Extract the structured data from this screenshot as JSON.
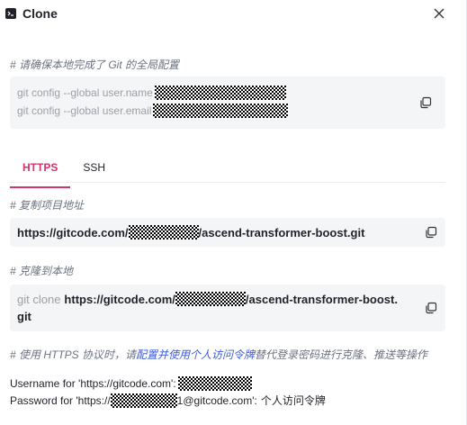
{
  "header": {
    "title": "Clone",
    "app_icon": "terminal-icon",
    "close_icon": "close-icon"
  },
  "config": {
    "note": "# 请确保本地完成了 Git 的全局配置",
    "line1": "git config --global user.name",
    "line2": "git config --global user.email"
  },
  "tabs": [
    {
      "label": "HTTPS",
      "active": true
    },
    {
      "label": "SSH",
      "active": false
    }
  ],
  "copy_url": {
    "note": "# 复制项目地址",
    "url_prefix": "https://gitcode.com/",
    "url_suffix": "/ascend-transformer-boost.git"
  },
  "clone_local": {
    "note": "# 克隆到本地",
    "cmd": "git clone",
    "url_prefix": "https://gitcode.com/",
    "url_suffix": "/ascend-transformer-boost.",
    "url_tail": "git"
  },
  "https_note": {
    "before": "# 使用 HTTPS 协议时，请",
    "link": "配置并使用个人访问令牌",
    "after": "替代登录密码进行克隆、推送等操作"
  },
  "credentials": {
    "username_prefix": "Username for 'https://gitcode.com':",
    "password_prefix": "Password for 'https://",
    "password_mid": "1@gitcode.com':",
    "password_value": "个人访问令牌"
  },
  "colors": {
    "accent": "#d6336c",
    "link": "#3b5bdb",
    "code_bg": "#f4f5f7"
  }
}
